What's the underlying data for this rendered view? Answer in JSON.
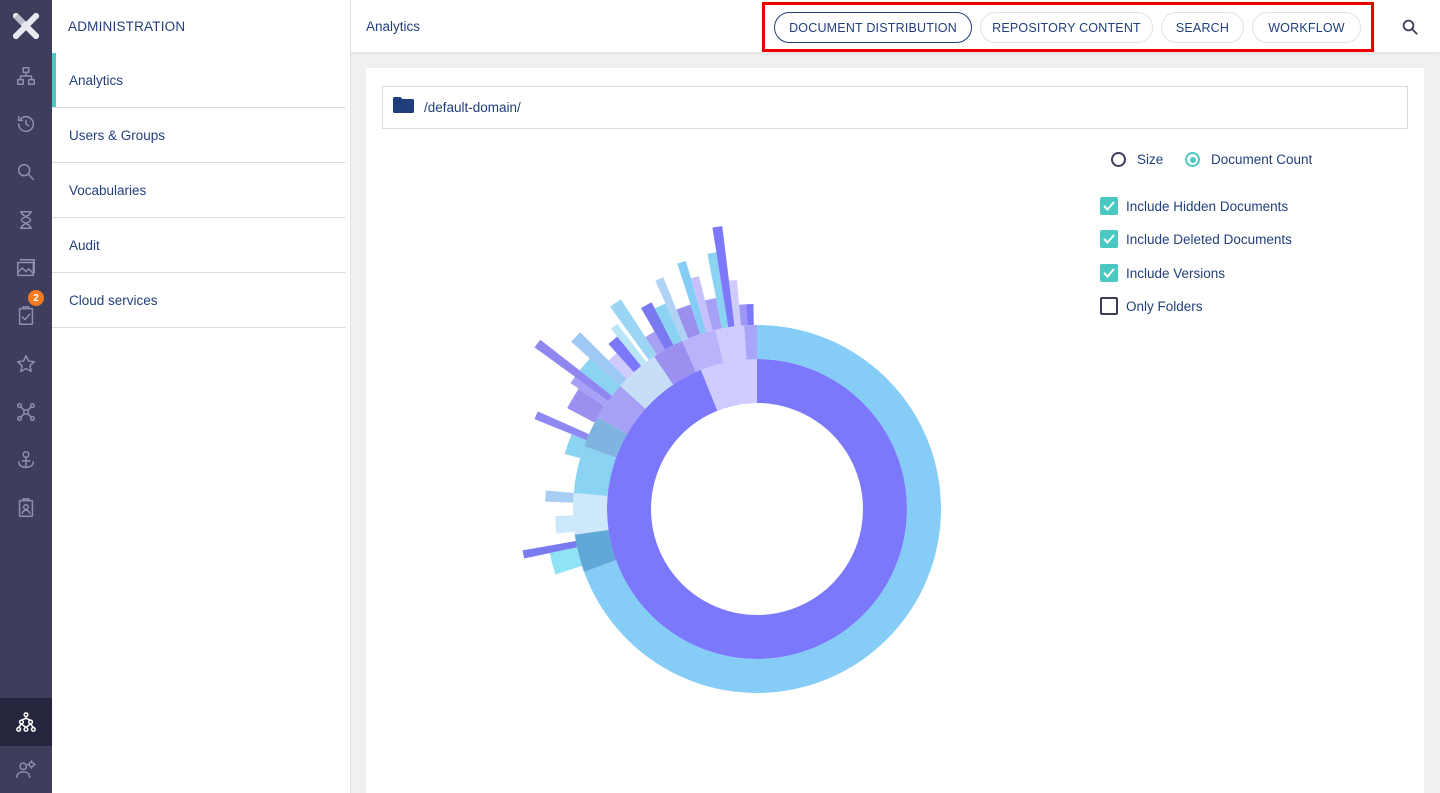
{
  "rail": {
    "logo": "nuxeo-x-logo",
    "items": [
      {
        "name": "browse-icon"
      },
      {
        "name": "recent-history-icon"
      },
      {
        "name": "search-icon"
      },
      {
        "name": "expired-hourglass-icon"
      },
      {
        "name": "collections-icon"
      },
      {
        "name": "tasks-icon",
        "badge": "2"
      },
      {
        "name": "favorites-star-icon"
      },
      {
        "name": "clipboard-network-icon"
      },
      {
        "name": "personal-workspace-icon"
      },
      {
        "name": "profile-clipboard-icon"
      },
      {
        "name": "administration-icon",
        "active": true
      },
      {
        "name": "user-settings-icon"
      }
    ]
  },
  "admin": {
    "title": "ADMINISTRATION",
    "menu": [
      {
        "label": "Analytics",
        "active": true
      },
      {
        "label": "Users & Groups"
      },
      {
        "label": "Vocabularies"
      },
      {
        "label": "Audit"
      },
      {
        "label": "Cloud services"
      }
    ]
  },
  "header": {
    "title": "Analytics",
    "tabs": [
      {
        "label": "DOCUMENT DISTRIBUTION",
        "active": true
      },
      {
        "label": "REPOSITORY CONTENT"
      },
      {
        "label": "SEARCH"
      },
      {
        "label": "WORKFLOW"
      }
    ],
    "search_icon": "search-icon"
  },
  "content": {
    "path": "/default-domain/",
    "folder_icon": "folder-icon",
    "metric_options": [
      {
        "label": "Size",
        "selected": false
      },
      {
        "label": "Document Count",
        "selected": true
      }
    ],
    "filters": [
      {
        "label": "Include Hidden Documents",
        "checked": true
      },
      {
        "label": "Include Deleted Documents",
        "checked": true
      },
      {
        "label": "Include Versions",
        "checked": true
      },
      {
        "label": "Only Folders",
        "checked": false
      }
    ]
  },
  "colors": {
    "accent": "#4bc8c2",
    "text": "#213f7d",
    "rail_bg": "#3e3e5c",
    "badge": "#f47b20",
    "highlight_border": "#ee0000",
    "ring_inner": "#7b78fb",
    "ring_outer": "#85cdf6"
  }
}
